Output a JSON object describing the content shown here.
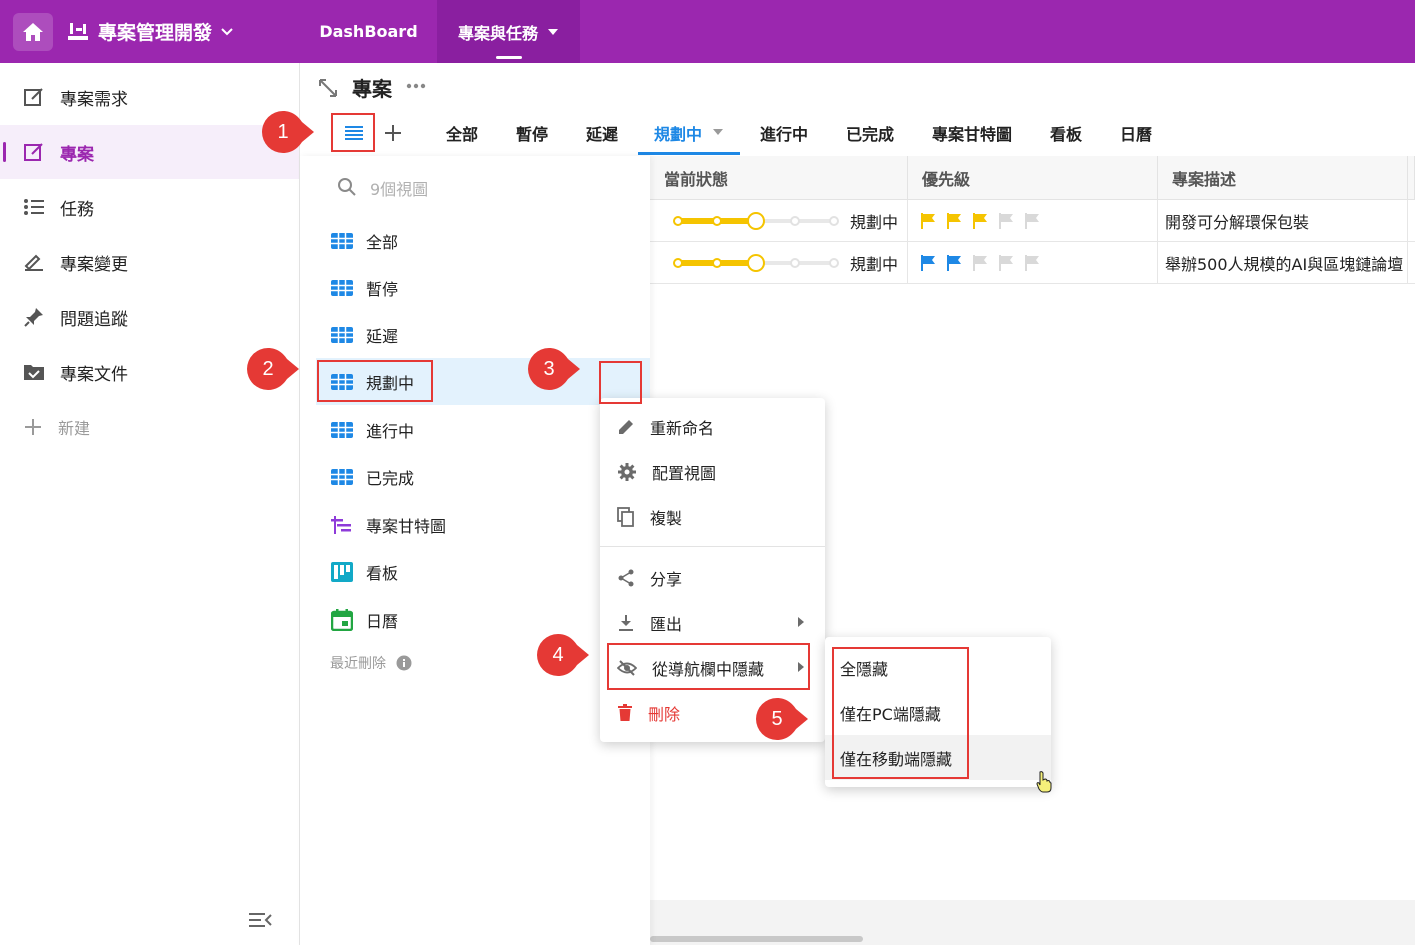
{
  "topbar": {
    "app_title": "專案管理開發",
    "tabs": [
      {
        "label": "DashBoard"
      },
      {
        "label": "專案與任務"
      }
    ]
  },
  "sidebar": {
    "items": [
      {
        "label": "專案需求",
        "icon": "edit-note-icon"
      },
      {
        "label": "專案",
        "icon": "edit-note-icon"
      },
      {
        "label": "任務",
        "icon": "list-icon"
      },
      {
        "label": "專案變更",
        "icon": "sign-icon"
      },
      {
        "label": "問題追蹤",
        "icon": "pin-icon"
      },
      {
        "label": "專案文件",
        "icon": "folder-check-icon"
      }
    ],
    "new_label": "新建"
  },
  "main": {
    "page_title": "專案",
    "view_tabs": [
      "全部",
      "暫停",
      "延遲",
      "規劃中",
      "進行中",
      "已完成",
      "專案甘特圖",
      "看板",
      "日曆"
    ],
    "active_tab": "規劃中"
  },
  "views_panel": {
    "search_placeholder": "9個視圖",
    "items": [
      {
        "label": "全部",
        "icon": "grid-icon"
      },
      {
        "label": "暫停",
        "icon": "grid-icon"
      },
      {
        "label": "延遲",
        "icon": "grid-icon"
      },
      {
        "label": "規劃中",
        "icon": "grid-icon"
      },
      {
        "label": "進行中",
        "icon": "grid-icon"
      },
      {
        "label": "已完成",
        "icon": "grid-icon"
      },
      {
        "label": "專案甘特圖",
        "icon": "gantt-icon"
      },
      {
        "label": "看板",
        "icon": "kanban-icon"
      },
      {
        "label": "日曆",
        "icon": "calendar-icon"
      }
    ],
    "recently_deleted": "最近刪除"
  },
  "context_menu": {
    "items": [
      {
        "label": "重新命名",
        "icon": "pencil-icon"
      },
      {
        "label": "配置視圖",
        "icon": "gear-icon"
      },
      {
        "label": "複製",
        "icon": "copy-icon"
      },
      {
        "label": "分享",
        "icon": "share-icon"
      },
      {
        "label": "匯出",
        "icon": "download-icon"
      },
      {
        "label": "從導航欄中隱藏",
        "icon": "eye-off-icon"
      },
      {
        "label": "刪除",
        "icon": "trash-icon"
      }
    ]
  },
  "submenu": {
    "items": [
      {
        "label": "全隱藏"
      },
      {
        "label": "僅在PC端隱藏"
      },
      {
        "label": "僅在移動端隱藏"
      }
    ]
  },
  "table": {
    "headers": [
      "當前狀態",
      "優先級",
      "專案描述"
    ],
    "rows": [
      {
        "status": "規劃中",
        "progress": 0.5,
        "priority": 3,
        "flag_color": "#f5c400",
        "description": "開發可分解環保包裝"
      },
      {
        "status": "規劃中",
        "progress": 0.5,
        "priority": 2,
        "flag_color": "#1e88e5",
        "description": "舉辦500人規模的AI與區塊鏈論壇"
      }
    ]
  },
  "markers": [
    "1",
    "2",
    "3",
    "4",
    "5"
  ],
  "colors": {
    "brand": "#9b27af",
    "accent": "#1e88e5",
    "marker": "#e53935",
    "progress": "#f5c400"
  }
}
